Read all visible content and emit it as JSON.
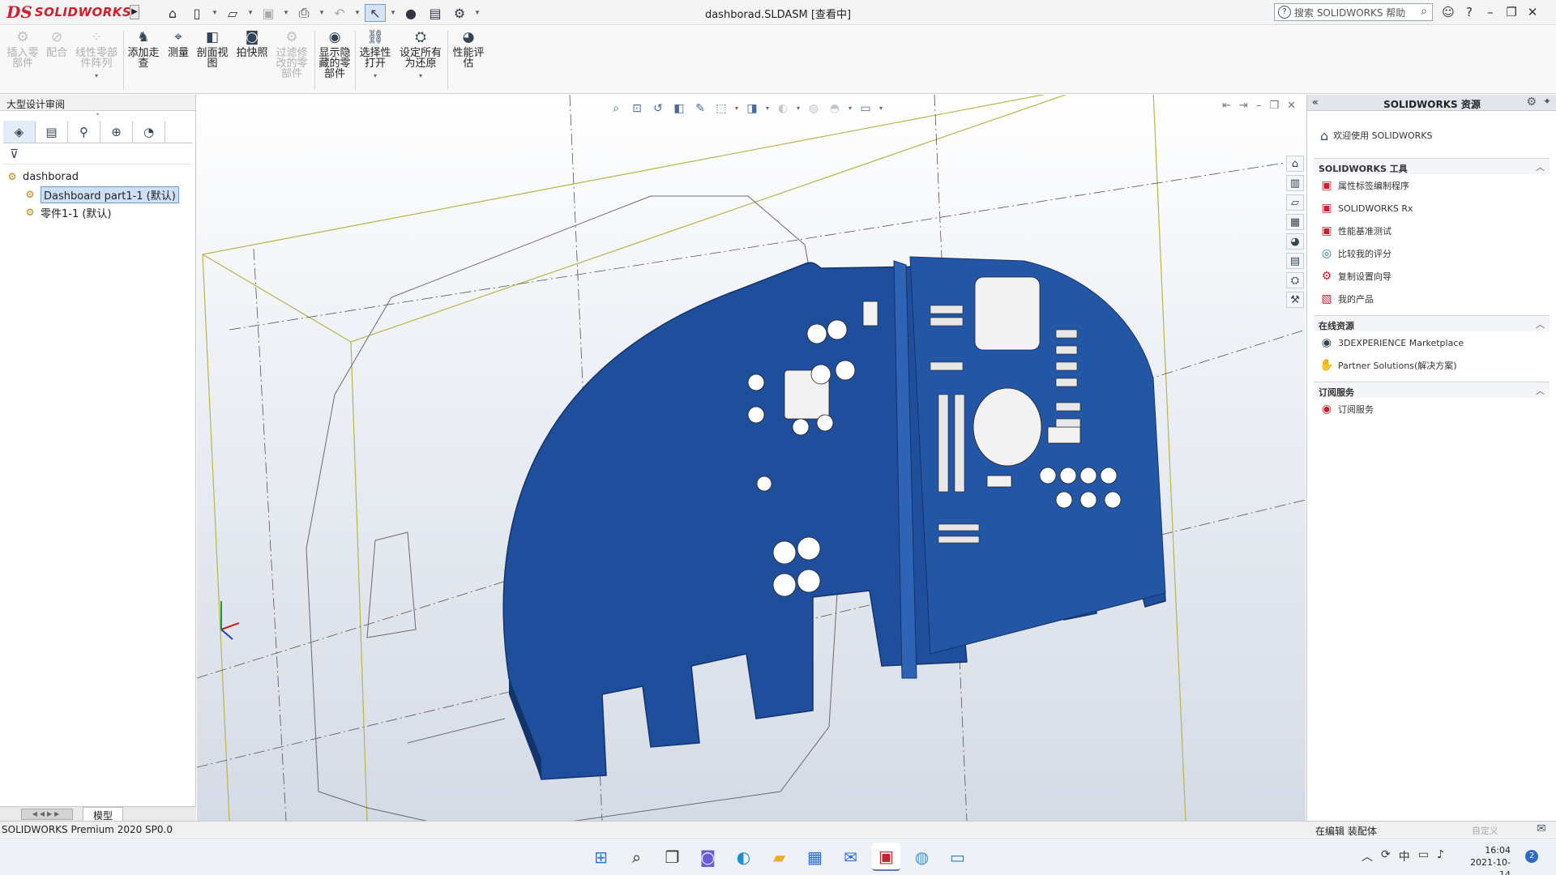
{
  "app": {
    "logo_mark": "DS",
    "logo_text": "SOLIDWORKS",
    "document_title": "dashborad.SLDASM [查看中]"
  },
  "titlebar": {
    "search_placeholder": "搜索 SOLIDWORKS 帮助",
    "help": "?",
    "quick_icons": [
      "home-icon",
      "new-icon",
      "open-icon",
      "save-icon",
      "print-icon",
      "undo-icon",
      "select-icon",
      "traffic-light-icon",
      "file-props-icon",
      "options-icon"
    ]
  },
  "ribbon": {
    "insert_part": "插入零部件",
    "mate": "配合",
    "linear_pattern": "线性零部件阵列",
    "add_walkthrough": "添加走查",
    "measure": "测量",
    "section_view": "剖面视图",
    "snapshot": "拍快照",
    "filter_modified": "过滤修改的零部件",
    "show_hidden": "显示隐藏的零部件",
    "selective_open": "选择性打开",
    "set_all_resolved": "设定所有为还原",
    "perf_eval": "性能评估"
  },
  "left_panel": {
    "tab_label": "大型设计审阅",
    "tree_root": "dashborad",
    "tree_children": [
      "Dashboard part1-1 (默认)",
      "零件1-1 (默认)"
    ],
    "bottom_tab": "模型"
  },
  "right_panel": {
    "title": "SOLIDWORKS 资源",
    "welcome": "欢迎使用 SOLIDWORKS",
    "sections": [
      {
        "title": "SOLIDWORKS 工具",
        "items": [
          "属性标签编制程序",
          "SOLIDWORKS Rx",
          "性能基准测试",
          "比较我的评分",
          "复制设置向导",
          "我的产品"
        ]
      },
      {
        "title": "在线资源",
        "items": [
          "3DEXPERIENCE Marketplace",
          "Partner Solutions(解决方案)"
        ]
      },
      {
        "title": "订阅服务",
        "items": [
          "订阅服务"
        ]
      }
    ]
  },
  "statusbar": {
    "version": "SOLIDWORKS Premium 2020 SP0.0",
    "mode": "在编辑 装配体",
    "custom": "自定义"
  },
  "taskbar": {
    "ime": "中",
    "time": "16:04",
    "date": "2021-10-14",
    "notifications": "2"
  },
  "colors": {
    "brand_red": "#d01f2d",
    "model_blue": "#1f4f9c",
    "bbox_line": "#b8b54a",
    "selection": "#cfe0f6"
  }
}
